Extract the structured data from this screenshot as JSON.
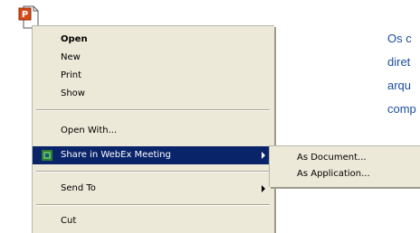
{
  "context_menu": {
    "items": [
      {
        "label": "Open"
      },
      {
        "label": "New"
      },
      {
        "label": "Print"
      },
      {
        "label": "Show"
      },
      {
        "label": "Open With..."
      },
      {
        "label": "Share in WebEx Meeting"
      },
      {
        "label": "Send To"
      },
      {
        "label": "Cut"
      }
    ]
  },
  "submenu": {
    "items": [
      {
        "label": "As Document..."
      },
      {
        "label": "As Application..."
      }
    ]
  },
  "background_text": {
    "lines": [
      "Os c",
      "diret",
      "arqu",
      "comp"
    ]
  },
  "colors": {
    "menu_bg": "#ece9d8",
    "highlight": "#0a246a",
    "side_text": "#1a4e9c"
  }
}
